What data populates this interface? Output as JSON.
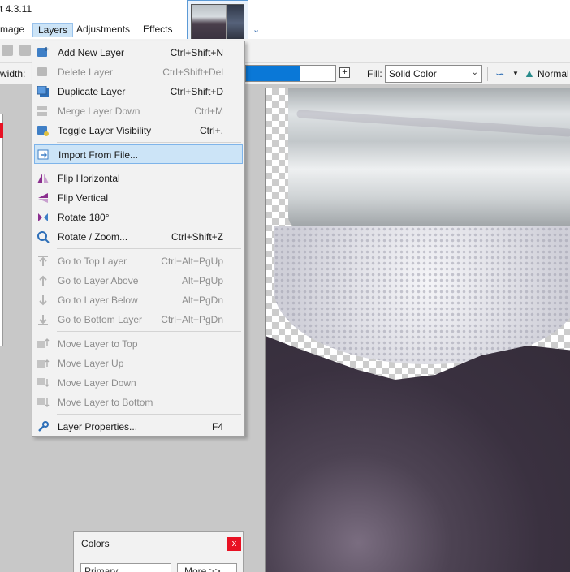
{
  "window": {
    "title_fragment": "t 4.3.11"
  },
  "menubar": {
    "items": [
      {
        "label": "mage"
      },
      {
        "label": "Layers"
      },
      {
        "label": "Adjustments"
      },
      {
        "label": "Effects"
      }
    ]
  },
  "toolbar": {
    "width_label": "width:",
    "fill_label": "Fill:",
    "fill_value": "Solid Color",
    "blend_label": "Normal"
  },
  "layers_menu": {
    "items": [
      {
        "label": "Add New Layer",
        "shortcut": "Ctrl+Shift+N",
        "enabled": true,
        "icon": "add-layer-icon"
      },
      {
        "label": "Delete Layer",
        "shortcut": "Ctrl+Shift+Del",
        "enabled": false,
        "icon": "delete-layer-icon"
      },
      {
        "label": "Duplicate Layer",
        "shortcut": "Ctrl+Shift+D",
        "enabled": true,
        "icon": "duplicate-layer-icon"
      },
      {
        "label": "Merge Layer Down",
        "shortcut": "Ctrl+M",
        "enabled": false,
        "icon": "merge-down-icon"
      },
      {
        "label": "Toggle Layer Visibility",
        "shortcut": "Ctrl+,",
        "enabled": true,
        "icon": "visibility-icon"
      },
      {
        "label": "Import From File...",
        "shortcut": "",
        "enabled": true,
        "highlighted": true,
        "icon": "import-file-icon"
      },
      {
        "label": "Flip Horizontal",
        "shortcut": "",
        "enabled": true,
        "icon": "flip-horizontal-icon"
      },
      {
        "label": "Flip Vertical",
        "shortcut": "",
        "enabled": true,
        "icon": "flip-vertical-icon"
      },
      {
        "label": "Rotate 180°",
        "shortcut": "",
        "enabled": true,
        "icon": "rotate-180-icon"
      },
      {
        "label": "Rotate / Zoom...",
        "shortcut": "Ctrl+Shift+Z",
        "enabled": true,
        "icon": "rotate-zoom-icon"
      },
      {
        "label": "Go to Top Layer",
        "shortcut": "Ctrl+Alt+PgUp",
        "enabled": false,
        "icon": "go-top-icon"
      },
      {
        "label": "Go to Layer Above",
        "shortcut": "Alt+PgUp",
        "enabled": false,
        "icon": "go-above-icon"
      },
      {
        "label": "Go to Layer Below",
        "shortcut": "Alt+PgDn",
        "enabled": false,
        "icon": "go-below-icon"
      },
      {
        "label": "Go to Bottom Layer",
        "shortcut": "Ctrl+Alt+PgDn",
        "enabled": false,
        "icon": "go-bottom-icon"
      },
      {
        "label": "Move Layer to Top",
        "shortcut": "",
        "enabled": false,
        "icon": "move-top-icon"
      },
      {
        "label": "Move Layer Up",
        "shortcut": "",
        "enabled": false,
        "icon": "move-up-icon"
      },
      {
        "label": "Move Layer Down",
        "shortcut": "",
        "enabled": false,
        "icon": "move-down-icon"
      },
      {
        "label": "Move Layer to Bottom",
        "shortcut": "",
        "enabled": false,
        "icon": "move-bottom-icon"
      },
      {
        "label": "Layer Properties...",
        "shortcut": "F4",
        "enabled": true,
        "icon": "wrench-icon"
      }
    ]
  },
  "colors_panel": {
    "title": "Colors",
    "primary_select": "Primary",
    "more_button": "More >>"
  },
  "colors": {
    "accent": "#0a78d7",
    "menu_highlight": "#cce4f7",
    "close_red": "#e81123"
  }
}
